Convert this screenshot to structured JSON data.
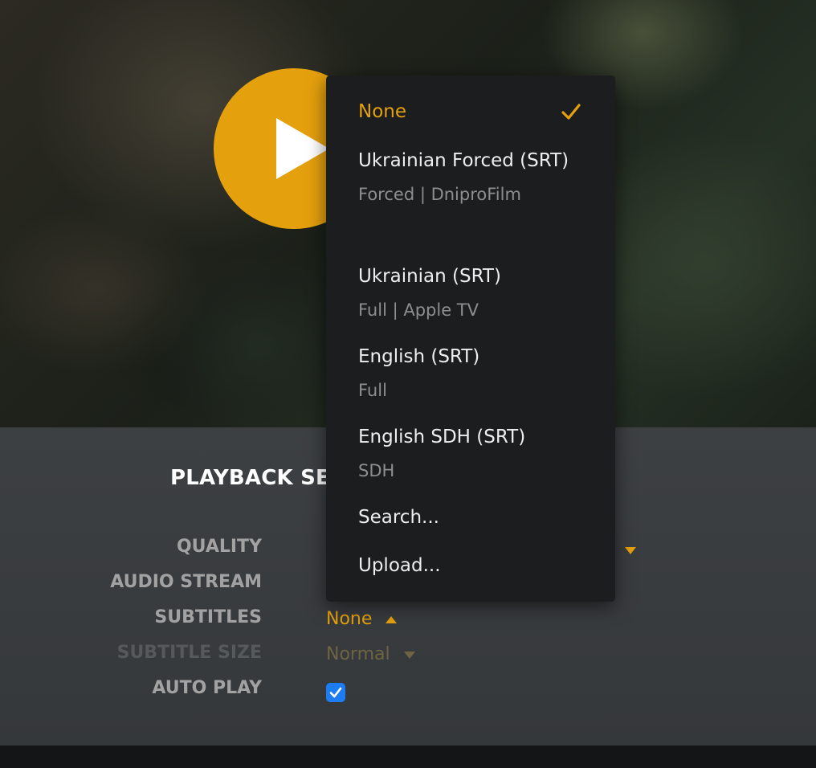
{
  "video": {
    "play_icon": "play-icon"
  },
  "settings": {
    "title": "PLAYBACK SE",
    "quality": {
      "label": "QUALITY",
      "value_fragment": ")"
    },
    "audio_stream": {
      "label": "AUDIO STREAM"
    },
    "subtitles": {
      "label": "SUBTITLES",
      "value": "None"
    },
    "subtitle_size": {
      "label": "SUBTITLE SIZE",
      "value": "Normal"
    },
    "auto_play": {
      "label": "AUTO PLAY",
      "checked": true
    }
  },
  "subtitle_menu": {
    "selected_index": 0,
    "options": [
      {
        "title": "None",
        "subtitle": ""
      },
      {
        "title": "Ukrainian Forced (SRT)",
        "subtitle": "Forced | DniproFilm"
      },
      {
        "title": "Ukrainian (SRT)",
        "subtitle": "Full | Apple TV"
      },
      {
        "title": "English (SRT)",
        "subtitle": "Full"
      },
      {
        "title": "English SDH (SRT)",
        "subtitle": "SDH"
      },
      {
        "title": "Search...",
        "subtitle": ""
      },
      {
        "title": "Upload...",
        "subtitle": ""
      }
    ]
  },
  "colors": {
    "accent": "#e5a00d",
    "menu_bg": "#1c1d1f",
    "panel_bg": "#3a3d40",
    "checkbox": "#1e7cf2"
  }
}
